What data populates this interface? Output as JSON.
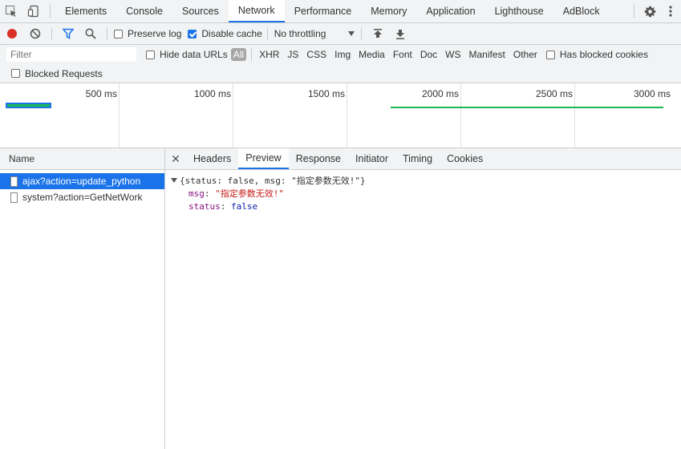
{
  "tabs": [
    {
      "label": "Elements",
      "active": false
    },
    {
      "label": "Console",
      "active": false
    },
    {
      "label": "Sources",
      "active": false
    },
    {
      "label": "Network",
      "active": true
    },
    {
      "label": "Performance",
      "active": false
    },
    {
      "label": "Memory",
      "active": false
    },
    {
      "label": "Application",
      "active": false
    },
    {
      "label": "Lighthouse",
      "active": false
    },
    {
      "label": "AdBlock",
      "active": false
    }
  ],
  "toolbar": {
    "preserve_log": "Preserve log",
    "disable_cache": "Disable cache",
    "throttling": "No throttling"
  },
  "filter": {
    "placeholder": "Filter",
    "hide_data_urls": "Hide data URLs",
    "types": [
      "All",
      "XHR",
      "JS",
      "CSS",
      "Img",
      "Media",
      "Font",
      "Doc",
      "WS",
      "Manifest",
      "Other"
    ],
    "has_blocked_cookies": "Has blocked cookies",
    "blocked_requests": "Blocked Requests"
  },
  "timeline": {
    "labels": [
      "500 ms",
      "1000 ms",
      "1500 ms",
      "2000 ms",
      "2500 ms",
      "3000 ms"
    ]
  },
  "requests": {
    "header": "Name",
    "items": [
      {
        "name": "ajax?action=update_python",
        "selected": true
      },
      {
        "name": "system?action=GetNetWork",
        "selected": false
      }
    ]
  },
  "detail": {
    "tabs": [
      {
        "label": "Headers",
        "active": false
      },
      {
        "label": "Preview",
        "active": true
      },
      {
        "label": "Response",
        "active": false
      },
      {
        "label": "Initiator",
        "active": false
      },
      {
        "label": "Timing",
        "active": false
      },
      {
        "label": "Cookies",
        "active": false
      }
    ],
    "preview": {
      "summary": "{status: false, msg: \"指定参数无效!\"}",
      "msg_key": "msg",
      "msg_value": "\"指定参数无效!\"",
      "status_key": "status",
      "status_value": "false"
    }
  },
  "colors": {
    "accent": "#1a73e8",
    "record": "#d93025",
    "bar_green": "#1db954"
  }
}
